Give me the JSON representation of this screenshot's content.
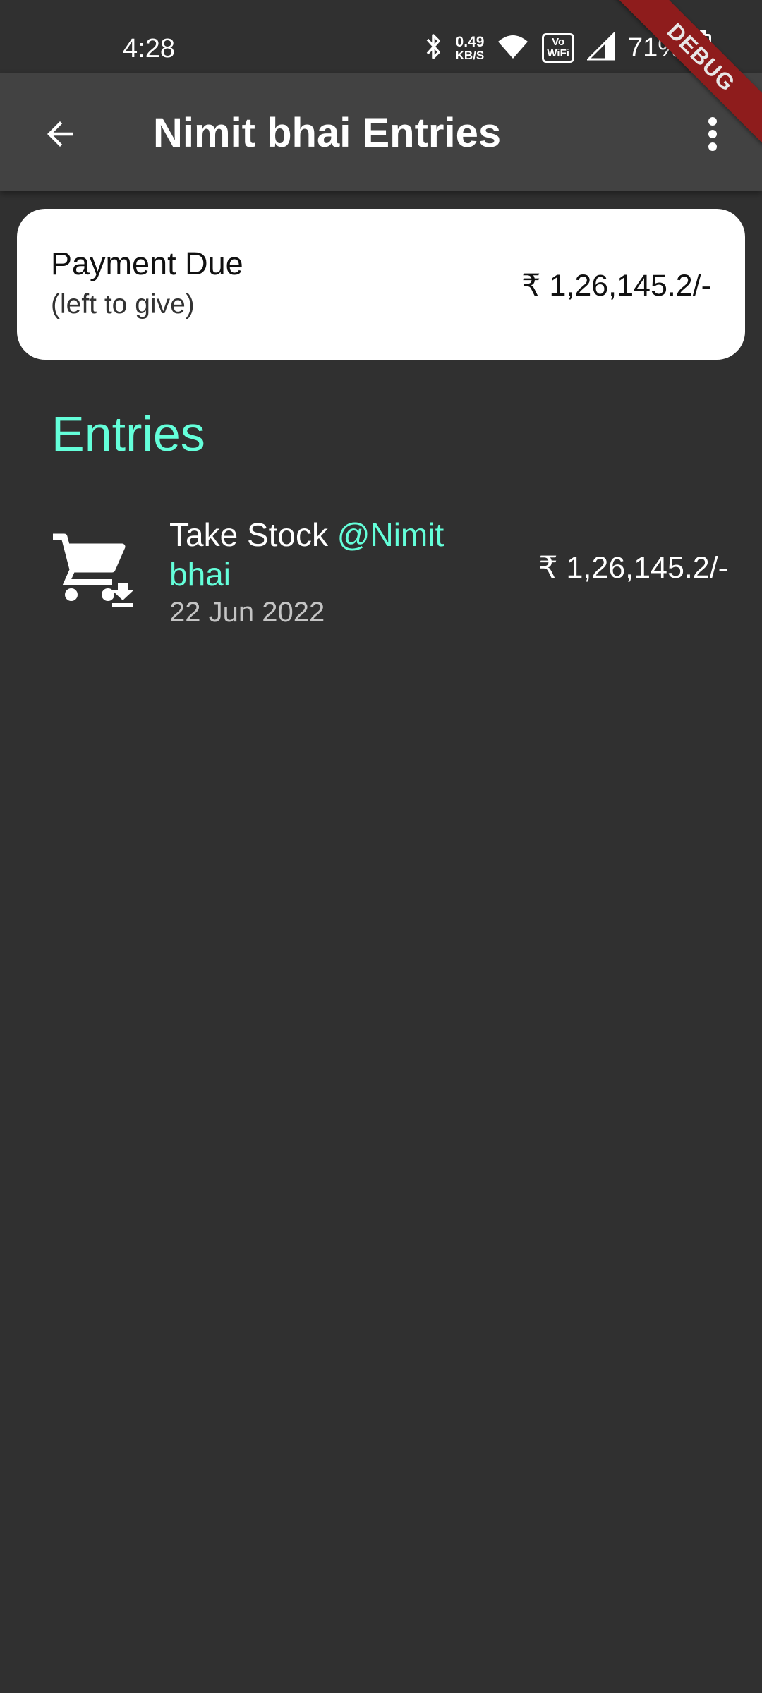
{
  "status_bar": {
    "time": "4:28",
    "net_speed_value": "0.49",
    "net_speed_unit": "KB/S",
    "vowifi_top": "Vo",
    "vowifi_bottom": "WiFi",
    "battery_percent": "71%",
    "battery_level": 0.71,
    "icons": [
      "bluetooth-icon",
      "wifi-icon",
      "vowifi-icon",
      "signal-icon",
      "battery-icon"
    ]
  },
  "debug_banner": "DEBUG",
  "app_bar": {
    "title": "Nimit bhai Entries",
    "back_icon": "arrow-back-icon",
    "menu_icon": "more-vert-icon"
  },
  "payment_card": {
    "title": "Payment Due",
    "subtitle": "(left to give)",
    "amount": "₹ 1,26,145.2/-"
  },
  "entries": {
    "section_title": "Entries",
    "items": [
      {
        "icon": "cart-download-icon",
        "action": "Take Stock ",
        "mention": "@Nimit bhai",
        "date": "22 Jun 2022",
        "amount": "₹ 1,26,145.2/-"
      }
    ]
  },
  "colors": {
    "background": "#303030",
    "app_bar": "#424242",
    "accent": "#64ffda",
    "card": "#ffffff",
    "debug_banner": "#8e1c1c"
  }
}
